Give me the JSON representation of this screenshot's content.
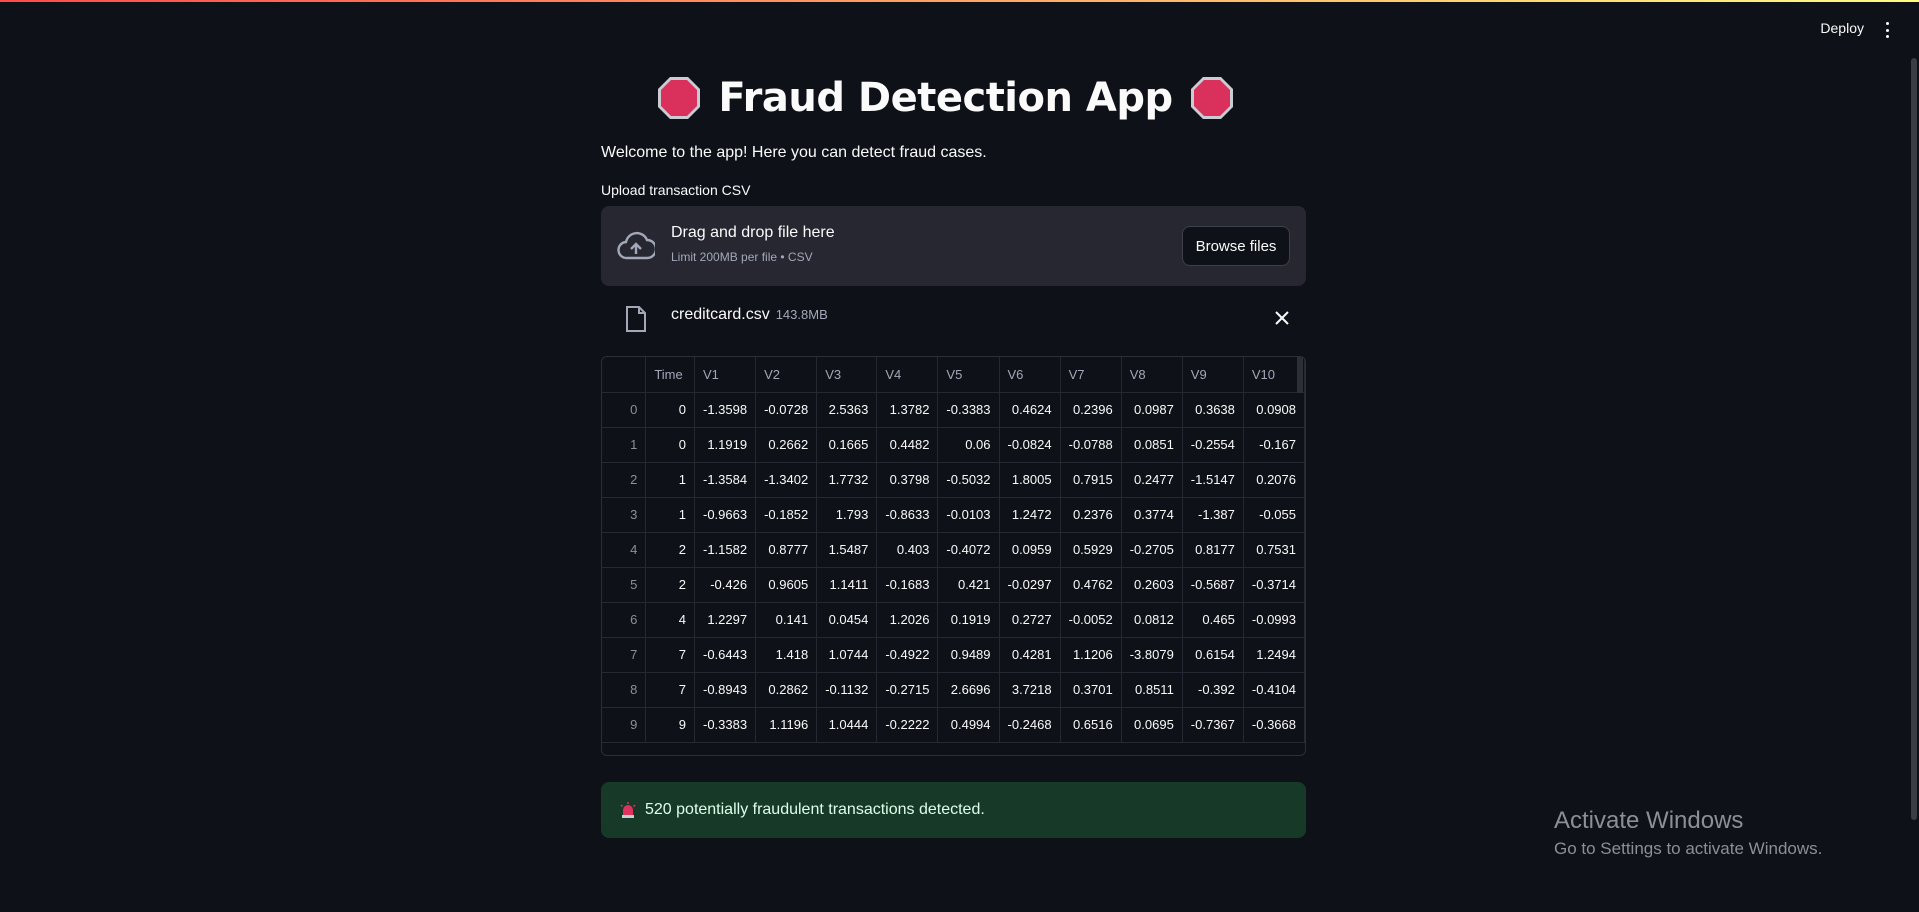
{
  "header": {
    "deploy_label": "Deploy"
  },
  "main": {
    "title": "Fraud Detection App",
    "welcome": "Welcome to the app! Here you can detect fraud cases."
  },
  "upload": {
    "label": "Upload transaction CSV",
    "dropzone_title": "Drag and drop file here",
    "dropzone_sub": "Limit 200MB per file • CSV",
    "browse_label": "Browse files",
    "file_name": "creditcard.csv",
    "file_size": "143.8MB"
  },
  "table": {
    "columns": [
      "",
      "Time",
      "V1",
      "V2",
      "V3",
      "V4",
      "V5",
      "V6",
      "V7",
      "V8",
      "V9",
      "V10"
    ],
    "rows": [
      [
        "0",
        "0",
        "-1.3598",
        "-0.0728",
        "2.5363",
        "1.3782",
        "-0.3383",
        "0.4624",
        "0.2396",
        "0.0987",
        "0.3638",
        "0.0908"
      ],
      [
        "1",
        "0",
        "1.1919",
        "0.2662",
        "0.1665",
        "0.4482",
        "0.06",
        "-0.0824",
        "-0.0788",
        "0.0851",
        "-0.2554",
        "-0.167"
      ],
      [
        "2",
        "1",
        "-1.3584",
        "-1.3402",
        "1.7732",
        "0.3798",
        "-0.5032",
        "1.8005",
        "0.7915",
        "0.2477",
        "-1.5147",
        "0.2076"
      ],
      [
        "3",
        "1",
        "-0.9663",
        "-0.1852",
        "1.793",
        "-0.8633",
        "-0.0103",
        "1.2472",
        "0.2376",
        "0.3774",
        "-1.387",
        "-0.055"
      ],
      [
        "4",
        "2",
        "-1.1582",
        "0.8777",
        "1.5487",
        "0.403",
        "-0.4072",
        "0.0959",
        "0.5929",
        "-0.2705",
        "0.8177",
        "0.7531"
      ],
      [
        "5",
        "2",
        "-0.426",
        "0.9605",
        "1.1411",
        "-0.1683",
        "0.421",
        "-0.0297",
        "0.4762",
        "0.2603",
        "-0.5687",
        "-0.3714"
      ],
      [
        "6",
        "4",
        "1.2297",
        "0.141",
        "0.0454",
        "1.2026",
        "0.1919",
        "0.2727",
        "-0.0052",
        "0.0812",
        "0.465",
        "-0.0993"
      ],
      [
        "7",
        "7",
        "-0.6443",
        "1.418",
        "1.0744",
        "-0.4922",
        "0.9489",
        "0.4281",
        "1.1206",
        "-3.8079",
        "0.6154",
        "1.2494"
      ],
      [
        "8",
        "7",
        "-0.8943",
        "0.2862",
        "-0.1132",
        "-0.2715",
        "2.6696",
        "3.7218",
        "0.3701",
        "0.8511",
        "-0.392",
        "-0.4104"
      ],
      [
        "9",
        "9",
        "-0.3383",
        "1.1196",
        "1.0444",
        "-0.2222",
        "0.4994",
        "-0.2468",
        "0.6516",
        "0.0695",
        "-0.7367",
        "-0.3668"
      ]
    ]
  },
  "alert": {
    "text": "520 potentially fraudulent transactions detected."
  },
  "watermark": {
    "title": "Activate Windows",
    "subtitle": "Go to Settings to activate Windows."
  },
  "colors": {
    "background": "#0e1117",
    "stop_sign": "#e0325e",
    "alert_bg": "#173928"
  }
}
